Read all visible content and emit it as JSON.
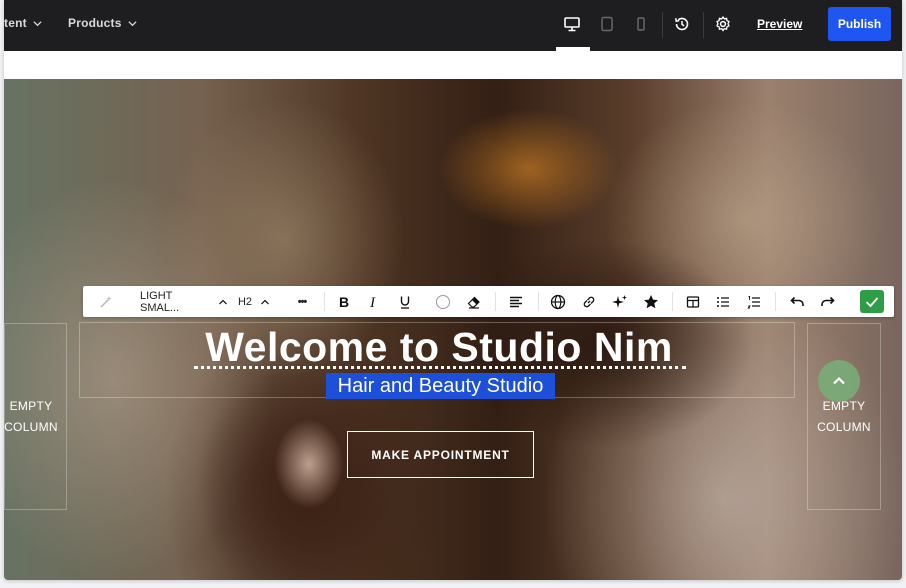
{
  "topbar": {
    "nav": [
      {
        "label": "tent"
      },
      {
        "label": "Products"
      }
    ],
    "preview_label": "Preview",
    "publish_label": "Publish",
    "devices": [
      "desktop-icon",
      "tablet-icon",
      "mobile-icon"
    ],
    "active_device": "desktop"
  },
  "toolbar": {
    "style_label": "LIGHT SMAL...",
    "heading_label": "H2",
    "more_label": "•••"
  },
  "hero": {
    "title": "Welcome to Studio Nim",
    "subtitle": "Hair and Beauty Studio",
    "cta_label": "MAKE APPOINTMENT",
    "empty_left": [
      "EMPTY",
      "COLUMN"
    ],
    "empty_right": [
      "EMPTY",
      "COLUMN"
    ]
  },
  "colors": {
    "topbar_bg": "#1e1e20",
    "publish_bg": "#1f55f0",
    "selection_bg": "#1e4fd8",
    "confirm_bg": "#2e9e46"
  }
}
